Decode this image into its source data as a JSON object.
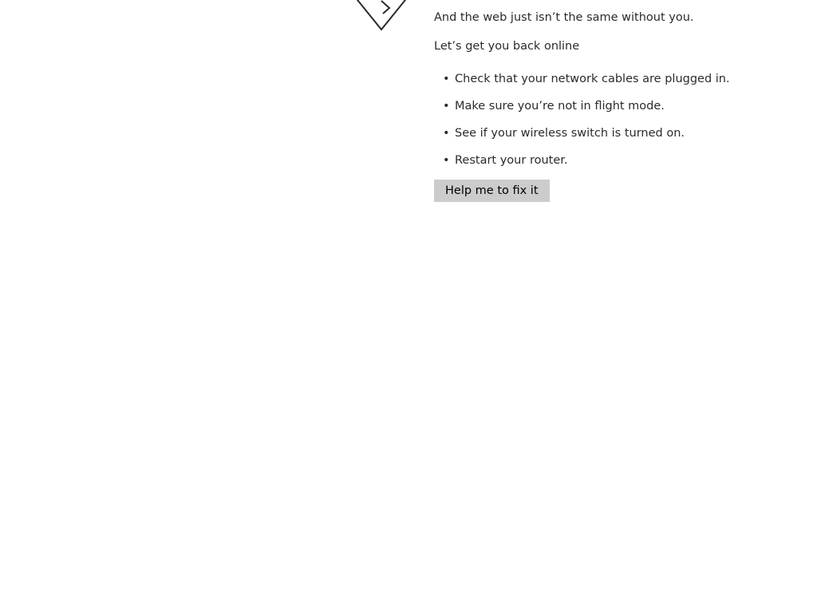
{
  "error": {
    "subtitle": "And the web just isn’t the same without you.",
    "back_online": "Let’s get you back online",
    "tips": [
      "Check that your network cables are plugged in.",
      "Make sure you’re not in flight mode.",
      "See if your wireless switch is turned on.",
      "Restart your router."
    ],
    "bullet": "•",
    "fix_button_label": "Help me to fix it"
  },
  "icon": {
    "name": "disconnected-plug-icon",
    "stroke_color": "#2b2b2b"
  },
  "colors": {
    "background": "#ffffff",
    "text": "#2b2b2b",
    "button_bg": "#cccccc"
  }
}
